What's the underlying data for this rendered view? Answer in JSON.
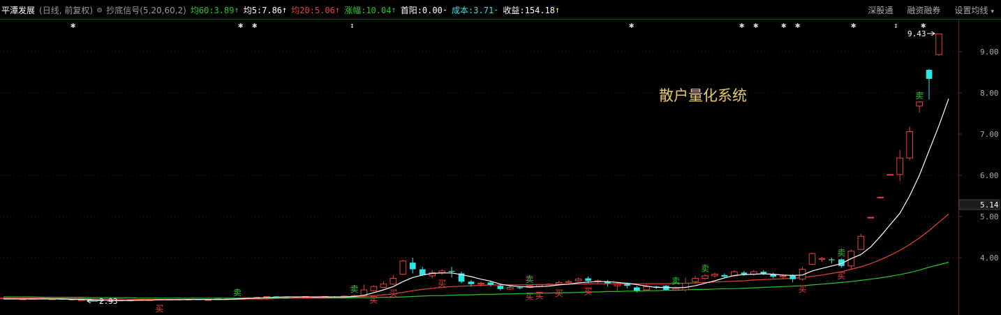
{
  "header": {
    "stock_name": "平潭发展",
    "period": "(日线, 前复权)",
    "indicator": "抄底信号(5,20,60,2)",
    "ma60": "均60:3.89",
    "ma5": "均5:7.86",
    "ma20": "均20:5.06",
    "change": "涨幅:10.04",
    "first_yang": "首阳:0.00",
    "cost": "成本:3.71",
    "profit": "收益:154.18",
    "arrow_up": "↑",
    "dash": "-"
  },
  "menu": {
    "shenguTong": "深股通",
    "margin": "融资融券",
    "ma_settings": "设置均线"
  },
  "watermark": "散户量化系统",
  "current_price": "5.14",
  "max_label": "9.43",
  "min_label": "2.93",
  "colors": {
    "up": "#e8413c",
    "down": "#2ee6e6",
    "ma5": "#ffffff",
    "ma20": "#e8413c",
    "ma60": "#27c72a",
    "buy": "#e8413c",
    "sell": "#27c72a"
  },
  "chart_data": {
    "type": "candlestick",
    "y_ticks": [
      "9.00",
      "8.00",
      "7.00",
      "6.00",
      "5.00",
      "4.00"
    ],
    "candles": [
      [
        3.02,
        3.02,
        3.01,
        3.03
      ],
      [
        3.01,
        3.0,
        2.99,
        3.02
      ],
      [
        3.0,
        3.0,
        2.99,
        3.01
      ],
      [
        3.0,
        3.01,
        2.99,
        3.02
      ],
      [
        3.01,
        3.0,
        2.99,
        3.02
      ],
      [
        3.0,
        3.0,
        2.99,
        3.01
      ],
      [
        3.0,
        2.99,
        2.98,
        3.01
      ],
      [
        2.99,
        2.98,
        2.97,
        3.0
      ],
      [
        2.98,
        2.98,
        2.97,
        2.99
      ],
      [
        2.98,
        2.97,
        2.96,
        2.99
      ],
      [
        2.97,
        2.95,
        2.93,
        2.98
      ],
      [
        2.95,
        2.96,
        2.94,
        2.97
      ],
      [
        2.96,
        2.97,
        2.95,
        2.98
      ],
      [
        2.97,
        2.97,
        2.96,
        2.98
      ],
      [
        2.97,
        2.98,
        2.96,
        2.99
      ],
      [
        2.98,
        2.98,
        2.97,
        2.99
      ],
      [
        2.98,
        2.99,
        2.97,
        3.0
      ],
      [
        2.99,
        2.99,
        2.98,
        3.0
      ],
      [
        2.99,
        2.98,
        2.97,
        3.0
      ],
      [
        2.98,
        2.99,
        2.97,
        3.0
      ],
      [
        2.99,
        2.98,
        2.97,
        3.0
      ],
      [
        2.98,
        2.98,
        2.97,
        2.99
      ],
      [
        2.98,
        3.0,
        2.97,
        3.01
      ],
      [
        3.0,
        3.01,
        2.99,
        3.02
      ],
      [
        3.01,
        3.01,
        3.0,
        3.02
      ],
      [
        3.01,
        3.03,
        3.0,
        3.04
      ],
      [
        3.03,
        3.04,
        3.02,
        3.05
      ],
      [
        3.04,
        3.06,
        3.03,
        3.07
      ],
      [
        3.06,
        3.05,
        3.04,
        3.07
      ],
      [
        3.05,
        3.04,
        3.03,
        3.06
      ],
      [
        3.04,
        3.05,
        3.03,
        3.06
      ],
      [
        3.05,
        3.06,
        3.04,
        3.07
      ],
      [
        3.05,
        3.04,
        3.02,
        3.06
      ],
      [
        3.04,
        3.06,
        3.03,
        3.07
      ],
      [
        3.06,
        3.05,
        3.04,
        3.07
      ],
      [
        3.05,
        3.07,
        3.04,
        3.08
      ],
      [
        3.07,
        3.08,
        3.06,
        3.1
      ],
      [
        3.08,
        3.22,
        3.07,
        3.35
      ],
      [
        3.2,
        3.3,
        3.18,
        3.33
      ],
      [
        3.28,
        3.36,
        3.25,
        3.42
      ],
      [
        3.36,
        3.5,
        3.34,
        3.58
      ],
      [
        3.6,
        3.92,
        3.58,
        3.95
      ],
      [
        3.88,
        3.72,
        3.62,
        4.0
      ],
      [
        3.72,
        3.58,
        3.55,
        3.78
      ],
      [
        3.56,
        3.64,
        3.5,
        3.7
      ],
      [
        3.64,
        3.68,
        3.58,
        3.72
      ],
      [
        3.68,
        3.66,
        3.52,
        3.78
      ],
      [
        3.62,
        3.42,
        3.38,
        3.66
      ],
      [
        3.42,
        3.36,
        3.3,
        3.46
      ],
      [
        3.36,
        3.38,
        3.3,
        3.42
      ],
      [
        3.4,
        3.34,
        3.3,
        3.44
      ],
      [
        3.32,
        3.24,
        3.2,
        3.36
      ],
      [
        3.24,
        3.28,
        3.22,
        3.32
      ],
      [
        3.28,
        3.26,
        3.24,
        3.3
      ],
      [
        3.28,
        3.32,
        3.26,
        3.34
      ],
      [
        3.3,
        3.34,
        3.28,
        3.36
      ],
      [
        3.34,
        3.36,
        3.32,
        3.38
      ],
      [
        3.36,
        3.4,
        3.34,
        3.44
      ],
      [
        3.4,
        3.42,
        3.38,
        3.46
      ],
      [
        3.44,
        3.48,
        3.42,
        3.52
      ],
      [
        3.5,
        3.44,
        3.38,
        3.54
      ],
      [
        3.44,
        3.44,
        3.38,
        3.48
      ],
      [
        3.42,
        3.38,
        3.3,
        3.46
      ],
      [
        3.32,
        3.36,
        3.2,
        3.4
      ],
      [
        3.36,
        3.32,
        3.26,
        3.4
      ],
      [
        3.28,
        3.2,
        3.16,
        3.32
      ],
      [
        3.22,
        3.3,
        3.2,
        3.36
      ],
      [
        3.3,
        3.28,
        3.24,
        3.32
      ],
      [
        3.32,
        3.22,
        3.2,
        3.34
      ],
      [
        3.22,
        3.26,
        3.2,
        3.3
      ],
      [
        3.22,
        3.38,
        3.18,
        3.52
      ],
      [
        3.42,
        3.5,
        3.4,
        3.56
      ],
      [
        3.5,
        3.56,
        3.46,
        3.6
      ],
      [
        3.56,
        3.6,
        3.52,
        3.64
      ],
      [
        3.58,
        3.54,
        3.5,
        3.62
      ],
      [
        3.56,
        3.66,
        3.52,
        3.7
      ],
      [
        3.64,
        3.6,
        3.56,
        3.68
      ],
      [
        3.6,
        3.66,
        3.56,
        3.7
      ],
      [
        3.66,
        3.62,
        3.58,
        3.7
      ],
      [
        3.6,
        3.54,
        3.5,
        3.64
      ],
      [
        3.54,
        3.56,
        3.5,
        3.6
      ],
      [
        3.56,
        3.48,
        3.4,
        3.6
      ],
      [
        3.48,
        3.72,
        3.44,
        3.78
      ],
      [
        3.84,
        4.1,
        3.82,
        4.12
      ],
      [
        3.96,
        3.98,
        3.9,
        4.02
      ],
      [
        3.96,
        3.94,
        3.86,
        4.0
      ],
      [
        3.96,
        3.8,
        3.76,
        3.98
      ],
      [
        3.8,
        4.16,
        3.72,
        4.2
      ],
      [
        4.2,
        4.52,
        4.2,
        4.58
      ],
      [
        4.98,
        4.98,
        4.98,
        4.98
      ],
      [
        5.47,
        5.47,
        5.47,
        5.47
      ],
      [
        6.02,
        6.02,
        6.02,
        6.02
      ],
      [
        6.02,
        6.42,
        5.86,
        6.62
      ],
      [
        6.42,
        7.06,
        6.36,
        7.18
      ],
      [
        7.68,
        7.78,
        7.52,
        7.8
      ],
      [
        8.56,
        8.34,
        7.84,
        8.58
      ],
      [
        8.93,
        9.43,
        8.9,
        9.43
      ]
    ],
    "ma5": [
      3.0,
      3.0,
      3.0,
      3.0,
      3.0,
      3.0,
      3.0,
      2.99,
      2.99,
      2.98,
      2.97,
      2.97,
      2.96,
      2.96,
      2.97,
      2.97,
      2.98,
      2.98,
      2.98,
      2.99,
      2.99,
      2.99,
      2.99,
      2.99,
      3.0,
      3.01,
      3.02,
      3.03,
      3.04,
      3.05,
      3.05,
      3.05,
      3.05,
      3.05,
      3.05,
      3.05,
      3.06,
      3.09,
      3.15,
      3.22,
      3.3,
      3.42,
      3.52,
      3.58,
      3.62,
      3.63,
      3.63,
      3.59,
      3.54,
      3.48,
      3.43,
      3.36,
      3.32,
      3.3,
      3.29,
      3.3,
      3.31,
      3.34,
      3.36,
      3.39,
      3.41,
      3.42,
      3.42,
      3.4,
      3.38,
      3.35,
      3.31,
      3.28,
      3.28,
      3.27,
      3.28,
      3.32,
      3.38,
      3.44,
      3.51,
      3.57,
      3.59,
      3.6,
      3.61,
      3.6,
      3.58,
      3.57,
      3.58,
      3.68,
      3.74,
      3.8,
      3.86,
      3.98,
      4.08,
      4.26,
      4.52,
      4.8,
      5.08,
      5.5,
      6.0,
      6.6,
      7.2,
      7.86
    ],
    "ma20": [
      3.02,
      3.02,
      3.02,
      3.02,
      3.02,
      3.01,
      3.01,
      3.01,
      3.01,
      3.0,
      3.0,
      3.0,
      3.0,
      2.99,
      2.99,
      2.99,
      2.99,
      2.99,
      2.99,
      2.99,
      2.99,
      2.99,
      2.99,
      2.99,
      2.99,
      3.0,
      3.0,
      3.0,
      3.01,
      3.01,
      3.02,
      3.02,
      3.03,
      3.03,
      3.04,
      3.04,
      3.05,
      3.06,
      3.08,
      3.1,
      3.12,
      3.16,
      3.2,
      3.23,
      3.26,
      3.28,
      3.3,
      3.31,
      3.32,
      3.33,
      3.34,
      3.34,
      3.34,
      3.34,
      3.34,
      3.35,
      3.35,
      3.35,
      3.36,
      3.36,
      3.37,
      3.37,
      3.37,
      3.37,
      3.37,
      3.37,
      3.37,
      3.37,
      3.37,
      3.38,
      3.38,
      3.39,
      3.4,
      3.41,
      3.42,
      3.43,
      3.44,
      3.46,
      3.47,
      3.48,
      3.49,
      3.5,
      3.52,
      3.55,
      3.58,
      3.62,
      3.66,
      3.72,
      3.78,
      3.86,
      3.95,
      4.06,
      4.18,
      4.32,
      4.48,
      4.66,
      4.86,
      5.06
    ],
    "ma60": [
      3.05,
      3.05,
      3.05,
      3.05,
      3.04,
      3.04,
      3.04,
      3.04,
      3.04,
      3.03,
      3.03,
      3.03,
      3.03,
      3.03,
      3.02,
      3.02,
      3.02,
      3.02,
      3.02,
      3.02,
      3.02,
      3.02,
      3.02,
      3.02,
      3.02,
      3.02,
      3.02,
      3.02,
      3.02,
      3.02,
      3.02,
      3.02,
      3.02,
      3.02,
      3.02,
      3.02,
      3.03,
      3.03,
      3.03,
      3.04,
      3.04,
      3.05,
      3.06,
      3.07,
      3.08,
      3.08,
      3.09,
      3.1,
      3.1,
      3.11,
      3.11,
      3.12,
      3.12,
      3.13,
      3.13,
      3.14,
      3.14,
      3.15,
      3.15,
      3.16,
      3.17,
      3.17,
      3.18,
      3.18,
      3.19,
      3.19,
      3.2,
      3.2,
      3.21,
      3.21,
      3.22,
      3.23,
      3.23,
      3.24,
      3.25,
      3.25,
      3.26,
      3.27,
      3.28,
      3.29,
      3.3,
      3.31,
      3.32,
      3.34,
      3.36,
      3.38,
      3.4,
      3.42,
      3.45,
      3.48,
      3.51,
      3.55,
      3.59,
      3.64,
      3.7,
      3.77,
      3.83,
      3.89
    ],
    "buy_signals": [
      16,
      38,
      40,
      45,
      54,
      55,
      57,
      60,
      82,
      86
    ],
    "sell_signals": [
      24,
      36,
      54,
      69,
      72,
      86,
      94,
      98
    ],
    "star_markers": [
      5,
      17,
      18,
      25,
      45,
      53,
      54,
      56,
      57,
      61,
      64,
      66
    ]
  }
}
